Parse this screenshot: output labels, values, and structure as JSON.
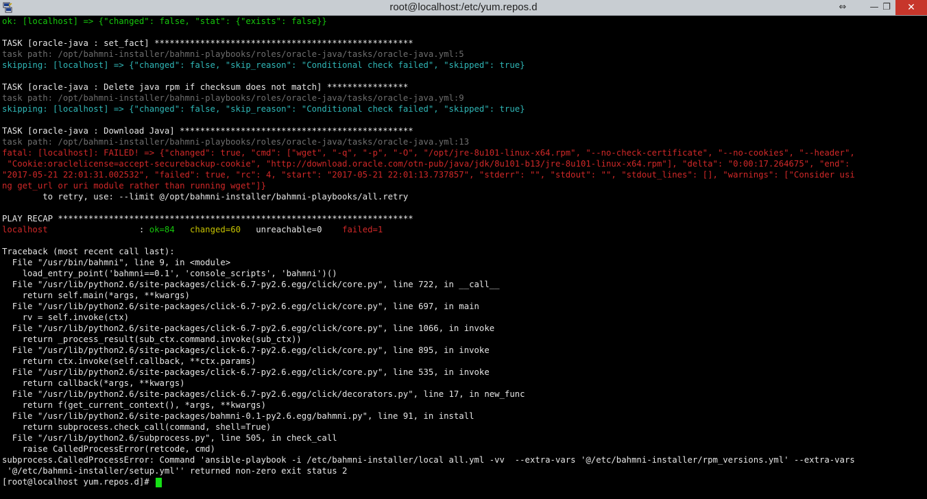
{
  "window": {
    "title": "root@localhost:/etc/yum.repos.d",
    "resize_glyph": "⇔",
    "minimize_glyph": "—",
    "maximize_glyph": "❐",
    "close_glyph": "✕"
  },
  "colors": {
    "ok": "#16c60c",
    "skip": "#2fb6b6",
    "path": "#6e6e6e",
    "error": "#d02828",
    "changed": "#c7c400",
    "text": "#e6e6e6",
    "background": "#000000"
  },
  "terminal": {
    "lines": [
      {
        "segs": [
          {
            "t": "ok: [localhost] => {\"changed\": false, \"stat\": {\"exists\": false}}",
            "c": "g"
          }
        ]
      },
      {
        "segs": []
      },
      {
        "segs": [
          {
            "t": "TASK [oracle-java : set_fact] ***************************************************",
            "c": "w"
          }
        ]
      },
      {
        "segs": [
          {
            "t": "task path: /opt/bahmni-installer/bahmni-playbooks/roles/oracle-java/tasks/oracle-java.yml:5",
            "c": "gr"
          }
        ]
      },
      {
        "segs": [
          {
            "t": "skipping: [localhost] => {\"changed\": false, \"skip_reason\": \"Conditional check failed\", \"skipped\": true}",
            "c": "c"
          }
        ]
      },
      {
        "segs": []
      },
      {
        "segs": [
          {
            "t": "TASK [oracle-java : Delete java rpm if checksum does not match] ****************",
            "c": "w"
          }
        ]
      },
      {
        "segs": [
          {
            "t": "task path: /opt/bahmni-installer/bahmni-playbooks/roles/oracle-java/tasks/oracle-java.yml:9",
            "c": "gr"
          }
        ]
      },
      {
        "segs": [
          {
            "t": "skipping: [localhost] => {\"changed\": false, \"skip_reason\": \"Conditional check failed\", \"skipped\": true}",
            "c": "c"
          }
        ]
      },
      {
        "segs": []
      },
      {
        "segs": [
          {
            "t": "TASK [oracle-java : Download Java] **********************************************",
            "c": "w"
          }
        ]
      },
      {
        "segs": [
          {
            "t": "task path: /opt/bahmni-installer/bahmni-playbooks/roles/oracle-java/tasks/oracle-java.yml:13",
            "c": "gr"
          }
        ]
      },
      {
        "segs": [
          {
            "t": "fatal: [localhost]: FAILED! => {\"changed\": true, \"cmd\": [\"wget\", \"-q\", \"-p\", \"-O\", \"/opt/jre-8u101-linux-x64.rpm\", \"--no-check-certificate\", \"--no-cookies\", \"--header\",",
            "c": "r"
          }
        ]
      },
      {
        "segs": [
          {
            "t": " \"Cookie:oraclelicense=accept-securebackup-cookie\", \"http://download.oracle.com/otn-pub/java/jdk/8u101-b13/jre-8u101-linux-x64.rpm\"], \"delta\": \"0:00:17.264675\", \"end\":",
            "c": "r"
          }
        ]
      },
      {
        "segs": [
          {
            "t": "\"2017-05-21 22:01:31.002532\", \"failed\": true, \"rc\": 4, \"start\": \"2017-05-21 22:01:13.737857\", \"stderr\": \"\", \"stdout\": \"\", \"stdout_lines\": [], \"warnings\": [\"Consider usi",
            "c": "r"
          }
        ]
      },
      {
        "segs": [
          {
            "t": "ng get_url or uri module rather than running wget\"]}",
            "c": "r"
          }
        ]
      },
      {
        "segs": [
          {
            "t": "        to retry, use: --limit @/opt/bahmni-installer/bahmni-playbooks/all.retry",
            "c": "w"
          }
        ]
      },
      {
        "segs": []
      },
      {
        "segs": [
          {
            "t": "PLAY RECAP **********************************************************************",
            "c": "w"
          }
        ]
      },
      {
        "segs": [
          {
            "t": "localhost",
            "c": "r"
          },
          {
            "t": "                  : ",
            "c": "w"
          },
          {
            "t": "ok=84",
            "c": "g"
          },
          {
            "t": "   ",
            "c": "w"
          },
          {
            "t": "changed=60",
            "c": "y"
          },
          {
            "t": "   unreachable=0    ",
            "c": "w"
          },
          {
            "t": "failed=1",
            "c": "r"
          }
        ]
      },
      {
        "segs": []
      },
      {
        "segs": [
          {
            "t": "Traceback (most recent call last):",
            "c": "w"
          }
        ]
      },
      {
        "segs": [
          {
            "t": "  File \"/usr/bin/bahmni\", line 9, in <module>",
            "c": "w"
          }
        ]
      },
      {
        "segs": [
          {
            "t": "    load_entry_point('bahmni==0.1', 'console_scripts', 'bahmni')()",
            "c": "w"
          }
        ]
      },
      {
        "segs": [
          {
            "t": "  File \"/usr/lib/python2.6/site-packages/click-6.7-py2.6.egg/click/core.py\", line 722, in __call__",
            "c": "w"
          }
        ]
      },
      {
        "segs": [
          {
            "t": "    return self.main(*args, **kwargs)",
            "c": "w"
          }
        ]
      },
      {
        "segs": [
          {
            "t": "  File \"/usr/lib/python2.6/site-packages/click-6.7-py2.6.egg/click/core.py\", line 697, in main",
            "c": "w"
          }
        ]
      },
      {
        "segs": [
          {
            "t": "    rv = self.invoke(ctx)",
            "c": "w"
          }
        ]
      },
      {
        "segs": [
          {
            "t": "  File \"/usr/lib/python2.6/site-packages/click-6.7-py2.6.egg/click/core.py\", line 1066, in invoke",
            "c": "w"
          }
        ]
      },
      {
        "segs": [
          {
            "t": "    return _process_result(sub_ctx.command.invoke(sub_ctx))",
            "c": "w"
          }
        ]
      },
      {
        "segs": [
          {
            "t": "  File \"/usr/lib/python2.6/site-packages/click-6.7-py2.6.egg/click/core.py\", line 895, in invoke",
            "c": "w"
          }
        ]
      },
      {
        "segs": [
          {
            "t": "    return ctx.invoke(self.callback, **ctx.params)",
            "c": "w"
          }
        ]
      },
      {
        "segs": [
          {
            "t": "  File \"/usr/lib/python2.6/site-packages/click-6.7-py2.6.egg/click/core.py\", line 535, in invoke",
            "c": "w"
          }
        ]
      },
      {
        "segs": [
          {
            "t": "    return callback(*args, **kwargs)",
            "c": "w"
          }
        ]
      },
      {
        "segs": [
          {
            "t": "  File \"/usr/lib/python2.6/site-packages/click-6.7-py2.6.egg/click/decorators.py\", line 17, in new_func",
            "c": "w"
          }
        ]
      },
      {
        "segs": [
          {
            "t": "    return f(get_current_context(), *args, **kwargs)",
            "c": "w"
          }
        ]
      },
      {
        "segs": [
          {
            "t": "  File \"/usr/lib/python2.6/site-packages/bahmni-0.1-py2.6.egg/bahmni.py\", line 91, in install",
            "c": "w"
          }
        ]
      },
      {
        "segs": [
          {
            "t": "    return subprocess.check_call(command, shell=True)",
            "c": "w"
          }
        ]
      },
      {
        "segs": [
          {
            "t": "  File \"/usr/lib/python2.6/subprocess.py\", line 505, in check_call",
            "c": "w"
          }
        ]
      },
      {
        "segs": [
          {
            "t": "    raise CalledProcessError(retcode, cmd)",
            "c": "w"
          }
        ]
      },
      {
        "segs": [
          {
            "t": "subprocess.CalledProcessError: Command 'ansible-playbook -i /etc/bahmni-installer/local all.yml -vv  --extra-vars '@/etc/bahmni-installer/rpm_versions.yml' --extra-vars",
            "c": "w"
          }
        ]
      },
      {
        "segs": [
          {
            "t": " '@/etc/bahmni-installer/setup.yml'' returned non-zero exit status 2",
            "c": "w"
          }
        ]
      }
    ],
    "prompt": "[root@localhost yum.repos.d]# "
  }
}
